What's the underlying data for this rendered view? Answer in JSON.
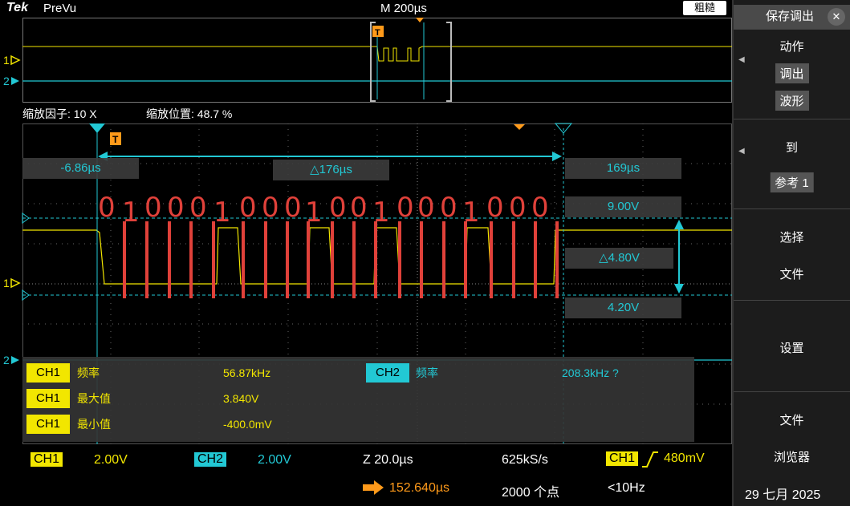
{
  "header": {
    "brand": "Tek",
    "mode": "PreVu",
    "timebase": "M 200µs",
    "acquire_button": "粗糙"
  },
  "zoom": {
    "factor_label": "缩放因子: 10 X",
    "position_label": "缩放位置: 48.7 %"
  },
  "cursors": {
    "t1": "-6.86µs",
    "delta_t": "△176µs",
    "t2": "169µs",
    "v1": "9.00V",
    "delta_v": "△4.80V",
    "v2": "4.20V"
  },
  "decoded_bits": [
    "0",
    "1",
    "0",
    "0",
    "0",
    "1",
    "0",
    "0",
    "0",
    "1",
    "0",
    "0",
    "1",
    "0",
    "0",
    "0",
    "1",
    "0",
    "0",
    "0"
  ],
  "channel_markers": {
    "ch1": "1",
    "ch2": "2"
  },
  "measurements": [
    {
      "channel": "CH1",
      "label": "频率",
      "value": "56.87kHz"
    },
    {
      "channel": "CH1",
      "label": "最大值",
      "value": "3.840V"
    },
    {
      "channel": "CH1",
      "label": "最小值",
      "value": "-400.0mV"
    }
  ],
  "measurement_ch2": {
    "channel": "CH2",
    "label": "频率",
    "value": "208.3kHz ?"
  },
  "bottom": {
    "ch1_tag": "CH1",
    "ch1_scale": "2.00V",
    "ch2_tag": "CH2",
    "ch2_scale": "2.00V",
    "zoom_scale": "Z 20.0µs",
    "sample_rate": "625kS/s",
    "trig_tag": "CH1",
    "trig_level": "480mV",
    "trig_pos": "152.640µs",
    "record_length": "2000 个点",
    "trig_freq": "<10Hz",
    "date": "29 七月 2025"
  },
  "sidebar": {
    "title": "保存调出",
    "action_label": "动作",
    "recall_chip": "调出",
    "waveform_chip": "波形",
    "to_label": "到",
    "ref_chip": "参考 1",
    "select_label": "选择",
    "file_label": "文件",
    "settings_label": "设置",
    "file2_label": "文件",
    "browser_label": "浏览器"
  },
  "colors": {
    "ch1": "#f2e600",
    "ch2": "#22c8d4",
    "trigger": "#ff9a1a",
    "decode": "#e0413a"
  }
}
